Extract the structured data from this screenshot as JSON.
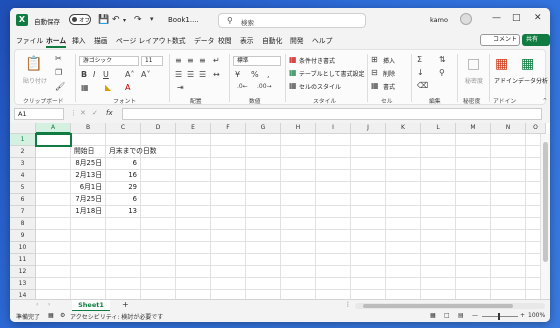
{
  "titlebar": {
    "autosave_label": "自動保存",
    "autosave_state": "オフ",
    "doc_title": "Book1....",
    "search_placeholder": "検索",
    "user_name": "kamo"
  },
  "menu": [
    "ファイル",
    "ホーム",
    "挿入",
    "描画",
    "ページ レイアウト",
    "数式",
    "データ",
    "校閲",
    "表示",
    "自動化",
    "開発",
    "ヘルプ"
  ],
  "menu_active": "ホーム",
  "comment_label": "コメント",
  "share_label": "共有",
  "ribbon": {
    "groups": [
      "クリップボード",
      "フォント",
      "配置",
      "数値",
      "スタイル",
      "セル",
      "編集",
      "秘密度",
      "アドイン"
    ],
    "paste_label": "貼り付け",
    "font_name": "游ゴシック",
    "font_size": "11",
    "number_format": "標準",
    "cond_format": "条件付き書式",
    "table_format": "テーブルとして書式設定",
    "cell_styles": "セルのスタイル",
    "insert": "挿入",
    "delete": "削除",
    "format": "書式",
    "sensitivity": "秘密度",
    "addins": "アドイン",
    "data_analysis": "データ分析"
  },
  "formula_bar": {
    "name_box": "A1",
    "fx": "fx"
  },
  "sheet": {
    "columns": [
      "A",
      "B",
      "C",
      "D",
      "E",
      "F",
      "G",
      "H",
      "I",
      "J",
      "K",
      "L",
      "M",
      "N",
      "O"
    ],
    "rows": [
      "1",
      "2",
      "3",
      "4",
      "5",
      "6",
      "7",
      "8",
      "9",
      "10",
      "11",
      "12",
      "13",
      "14",
      "15"
    ],
    "header_b": "開始日",
    "header_c": "月末までの日数",
    "data": [
      {
        "b": "8月25日",
        "c": "6"
      },
      {
        "b": "2月13日",
        "c": "16"
      },
      {
        "b": "6月1日",
        "c": "29"
      },
      {
        "b": "7月25日",
        "c": "6"
      },
      {
        "b": "1月18日",
        "c": "13"
      }
    ]
  },
  "tabs": {
    "sheet_name": "Sheet1"
  },
  "status": {
    "ready": "準備完了",
    "accessibility": "アクセシビリティ: 検討が必要です",
    "zoom": "100%"
  }
}
